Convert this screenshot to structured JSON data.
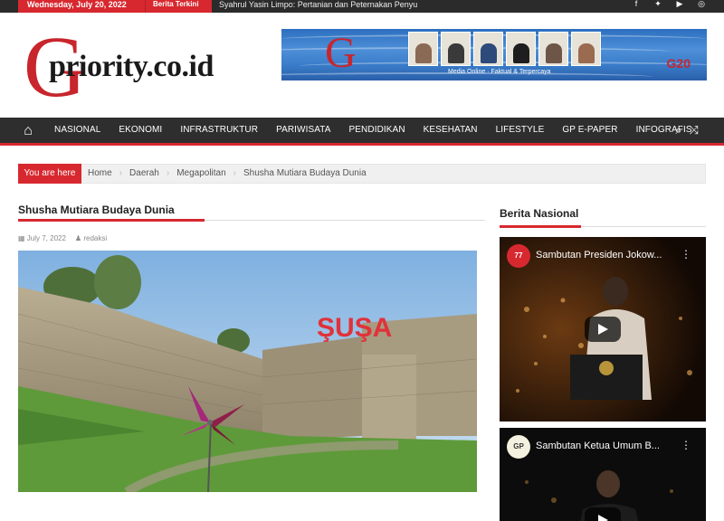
{
  "topbar": {
    "date": "Wednesday, July 20, 2022",
    "terkini_label": "Berita Terkini",
    "ticker": "Syahrul Yasin Limpo: Pertanian dan Peternakan Penyu",
    "social_icons": [
      "facebook-icon",
      "twitter-icon",
      "youtube-icon",
      "instagram-icon"
    ]
  },
  "header": {
    "logo_letter": "G",
    "logo_text": "priority.co.id",
    "banner_tagline": "Media Online · Faktual & Terpercaya",
    "banner_badge": "G20"
  },
  "nav": {
    "items": [
      "NASIONAL",
      "EKONOMI",
      "INFRASTRUKTUR",
      "PARIWISATA",
      "PENDIDIKAN",
      "KESEHATAN",
      "LIFESTYLE",
      "GP E-PAPER",
      "INFOGRAFIS"
    ]
  },
  "breadcrumb": {
    "label": "You are here",
    "items": [
      "Home",
      "Daerah",
      "Megapolitan",
      "Shusha Mutiara Budaya Dunia"
    ]
  },
  "article": {
    "title": "Shusha Mutiara Budaya Dunia",
    "date": "July 7, 2022",
    "author": "redaksi",
    "photo_sign": "ŞUŞA"
  },
  "sidebar": {
    "title": "Berita Nasional",
    "videos": [
      {
        "title": "Sambutan Presiden Jokow...",
        "channel_badge": "77"
      },
      {
        "title": "Sambutan Ketua Umum B...",
        "channel_badge": "GP"
      }
    ]
  },
  "colors": {
    "accent": "#d7282f",
    "nav_bg": "#2e2e2e",
    "topbar_bg": "#2b2b2b"
  }
}
